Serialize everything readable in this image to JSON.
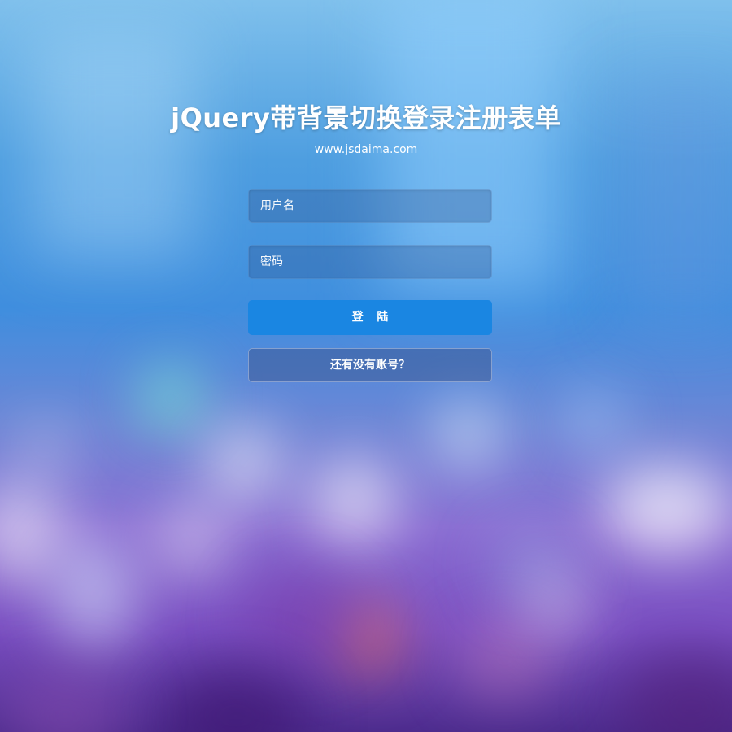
{
  "page": {
    "title": "jQuery带背景切换登录注册表单",
    "subtitle": "www.jsdaima.com"
  },
  "form": {
    "username_placeholder": "用户名",
    "password_placeholder": "密码",
    "login_label": "登 陆",
    "register_label": "还有没有账号？"
  },
  "colors": {
    "primary_button": "#1a86e2",
    "text": "#ffffff"
  }
}
